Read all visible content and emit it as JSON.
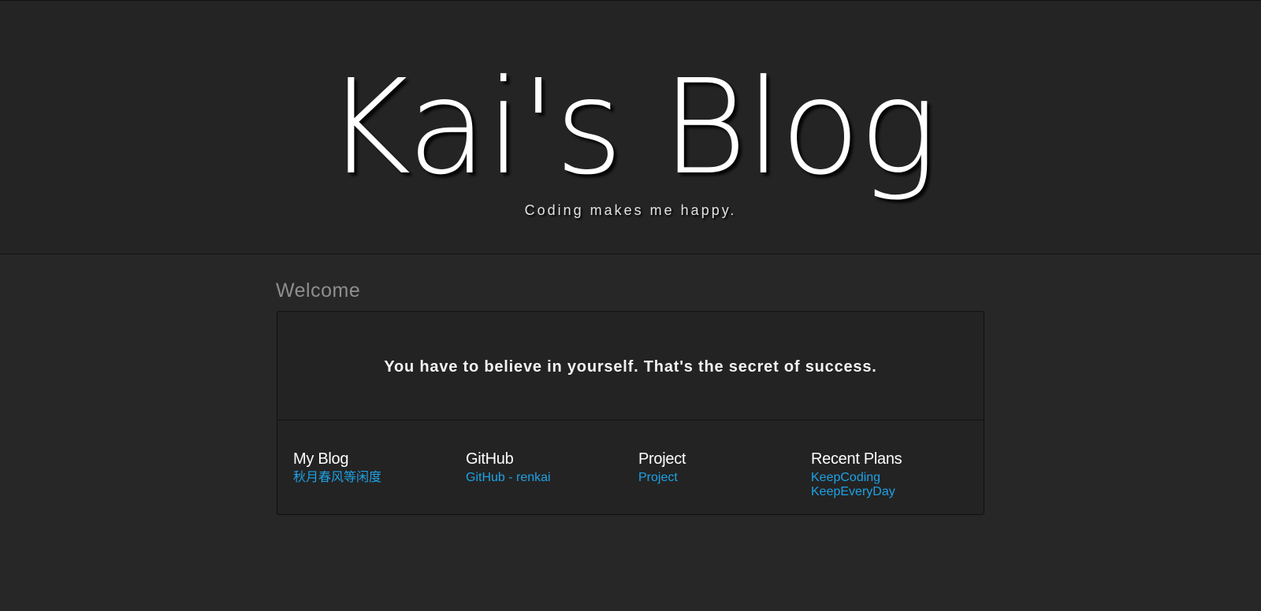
{
  "header": {
    "title": "Kai's Blog",
    "subtitle": "Coding makes me happy."
  },
  "welcome": {
    "heading": "Welcome",
    "quote": "You have to believe in yourself. That's the secret of success."
  },
  "footer": {
    "columns": [
      {
        "title": "My Blog",
        "links": [
          "秋月春风等闲度"
        ]
      },
      {
        "title": "GitHub",
        "links": [
          "GitHub - renkai"
        ]
      },
      {
        "title": "Project",
        "links": [
          "Project"
        ]
      },
      {
        "title": "Recent Plans",
        "links": [
          "KeepCoding",
          "KeepEveryDay"
        ]
      }
    ]
  },
  "colors": {
    "background": "#272727",
    "header_background": "#242424",
    "panel_background": "#232323",
    "heading_text": "#8e8e8e",
    "link": "#1ea1e4"
  }
}
